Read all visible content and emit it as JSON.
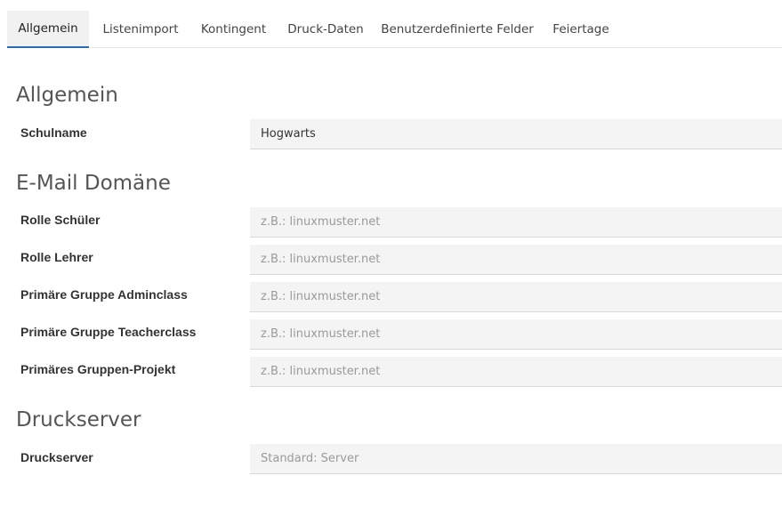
{
  "tabs": [
    {
      "label": "Allgemein",
      "active": true
    },
    {
      "label": "Listenimport",
      "active": false
    },
    {
      "label": "Kontingent",
      "active": false
    },
    {
      "label": "Druck-Daten",
      "active": false
    },
    {
      "label": "Benutzerdefinierte Felder",
      "active": false
    },
    {
      "label": "Feiertage",
      "active": false
    }
  ],
  "sections": {
    "general": {
      "title": "Allgemein",
      "school_name": {
        "label": "Schulname",
        "value": "Hogwarts"
      }
    },
    "email": {
      "title": "E-Mail Domäne",
      "fields": [
        {
          "label": "Rolle Schüler",
          "placeholder": "z.B.: linuxmuster.net"
        },
        {
          "label": "Rolle Lehrer",
          "placeholder": "z.B.: linuxmuster.net"
        },
        {
          "label": "Primäre Gruppe Adminclass",
          "placeholder": "z.B.: linuxmuster.net"
        },
        {
          "label": "Primäre Gruppe Teacherclass",
          "placeholder": "z.B.: linuxmuster.net"
        },
        {
          "label": "Primäres Gruppen-Projekt",
          "placeholder": "z.B.: linuxmuster.net"
        }
      ]
    },
    "printserver": {
      "title": "Druckserver",
      "field": {
        "label": "Druckserver",
        "placeholder": "Standard: Server"
      }
    }
  },
  "colors": {
    "active_tab_underline": "#2b6cb0",
    "active_tab_bg": "#f1f1f1",
    "input_bg": "#f4f4f4"
  }
}
